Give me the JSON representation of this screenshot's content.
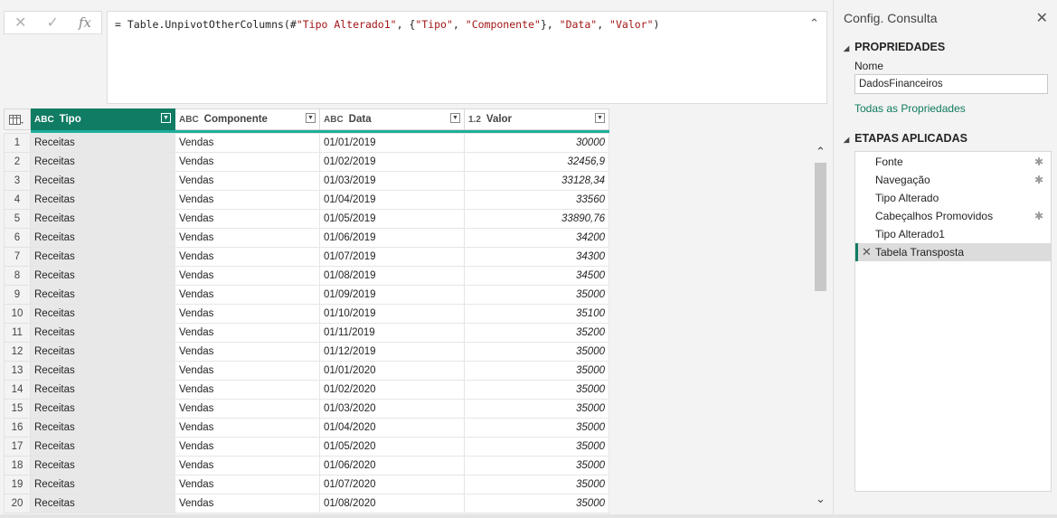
{
  "formula_bar": {
    "cancel_icon": "✕",
    "commit_icon": "✓",
    "fx_label": "fx",
    "prefix": "= Table.UnpivotOtherColumns(#",
    "arg1": "\"Tipo Alterado1\"",
    "mid1": ", {",
    "arg2": "\"Tipo\"",
    "mid2": ", ",
    "arg3": "\"Componente\"",
    "mid3": "}, ",
    "arg4": "\"Data\"",
    "mid4": ", ",
    "arg5": "\"Valor\"",
    "suffix": ")",
    "expand_icon": "chevron-up"
  },
  "table": {
    "columns": [
      {
        "type": "ABC",
        "name": "Tipo",
        "selected": true
      },
      {
        "type": "ABC",
        "name": "Componente",
        "selected": false
      },
      {
        "type": "ABC",
        "name": "Data",
        "selected": false
      },
      {
        "type": "1.2",
        "name": "Valor",
        "selected": false
      }
    ],
    "rows": [
      [
        "1",
        "Receitas",
        "Vendas",
        "01/01/2019",
        "30000"
      ],
      [
        "2",
        "Receitas",
        "Vendas",
        "01/02/2019",
        "32456,9"
      ],
      [
        "3",
        "Receitas",
        "Vendas",
        "01/03/2019",
        "33128,34"
      ],
      [
        "4",
        "Receitas",
        "Vendas",
        "01/04/2019",
        "33560"
      ],
      [
        "5",
        "Receitas",
        "Vendas",
        "01/05/2019",
        "33890,76"
      ],
      [
        "6",
        "Receitas",
        "Vendas",
        "01/06/2019",
        "34200"
      ],
      [
        "7",
        "Receitas",
        "Vendas",
        "01/07/2019",
        "34300"
      ],
      [
        "8",
        "Receitas",
        "Vendas",
        "01/08/2019",
        "34500"
      ],
      [
        "9",
        "Receitas",
        "Vendas",
        "01/09/2019",
        "35000"
      ],
      [
        "10",
        "Receitas",
        "Vendas",
        "01/10/2019",
        "35100"
      ],
      [
        "11",
        "Receitas",
        "Vendas",
        "01/11/2019",
        "35200"
      ],
      [
        "12",
        "Receitas",
        "Vendas",
        "01/12/2019",
        "35000"
      ],
      [
        "13",
        "Receitas",
        "Vendas",
        "01/01/2020",
        "35000"
      ],
      [
        "14",
        "Receitas",
        "Vendas",
        "01/02/2020",
        "35000"
      ],
      [
        "15",
        "Receitas",
        "Vendas",
        "01/03/2020",
        "35000"
      ],
      [
        "16",
        "Receitas",
        "Vendas",
        "01/04/2020",
        "35000"
      ],
      [
        "17",
        "Receitas",
        "Vendas",
        "01/05/2020",
        "35000"
      ],
      [
        "18",
        "Receitas",
        "Vendas",
        "01/06/2020",
        "35000"
      ],
      [
        "19",
        "Receitas",
        "Vendas",
        "01/07/2020",
        "35000"
      ],
      [
        "20",
        "Receitas",
        "Vendas",
        "01/08/2020",
        "35000"
      ]
    ]
  },
  "query_settings": {
    "title": "Config. Consulta",
    "properties_header": "PROPRIEDADES",
    "name_label": "Nome",
    "name_value": "DadosFinanceiros",
    "all_properties_link": "Todas as Propriedades",
    "steps_header": "ETAPAS APLICADAS",
    "steps": [
      {
        "label": "Fonte",
        "gear": true,
        "active": false
      },
      {
        "label": "Navegação",
        "gear": true,
        "active": false
      },
      {
        "label": "Tipo Alterado",
        "gear": false,
        "active": false
      },
      {
        "label": "Cabeçalhos Promovidos",
        "gear": true,
        "active": false
      },
      {
        "label": "Tipo Alterado1",
        "gear": false,
        "active": false
      },
      {
        "label": "Tabela Transposta",
        "gear": false,
        "active": true
      }
    ]
  },
  "colors": {
    "accent": "#107c63",
    "quality_bar": "#1fae9a",
    "string_literal": "#a31515"
  }
}
